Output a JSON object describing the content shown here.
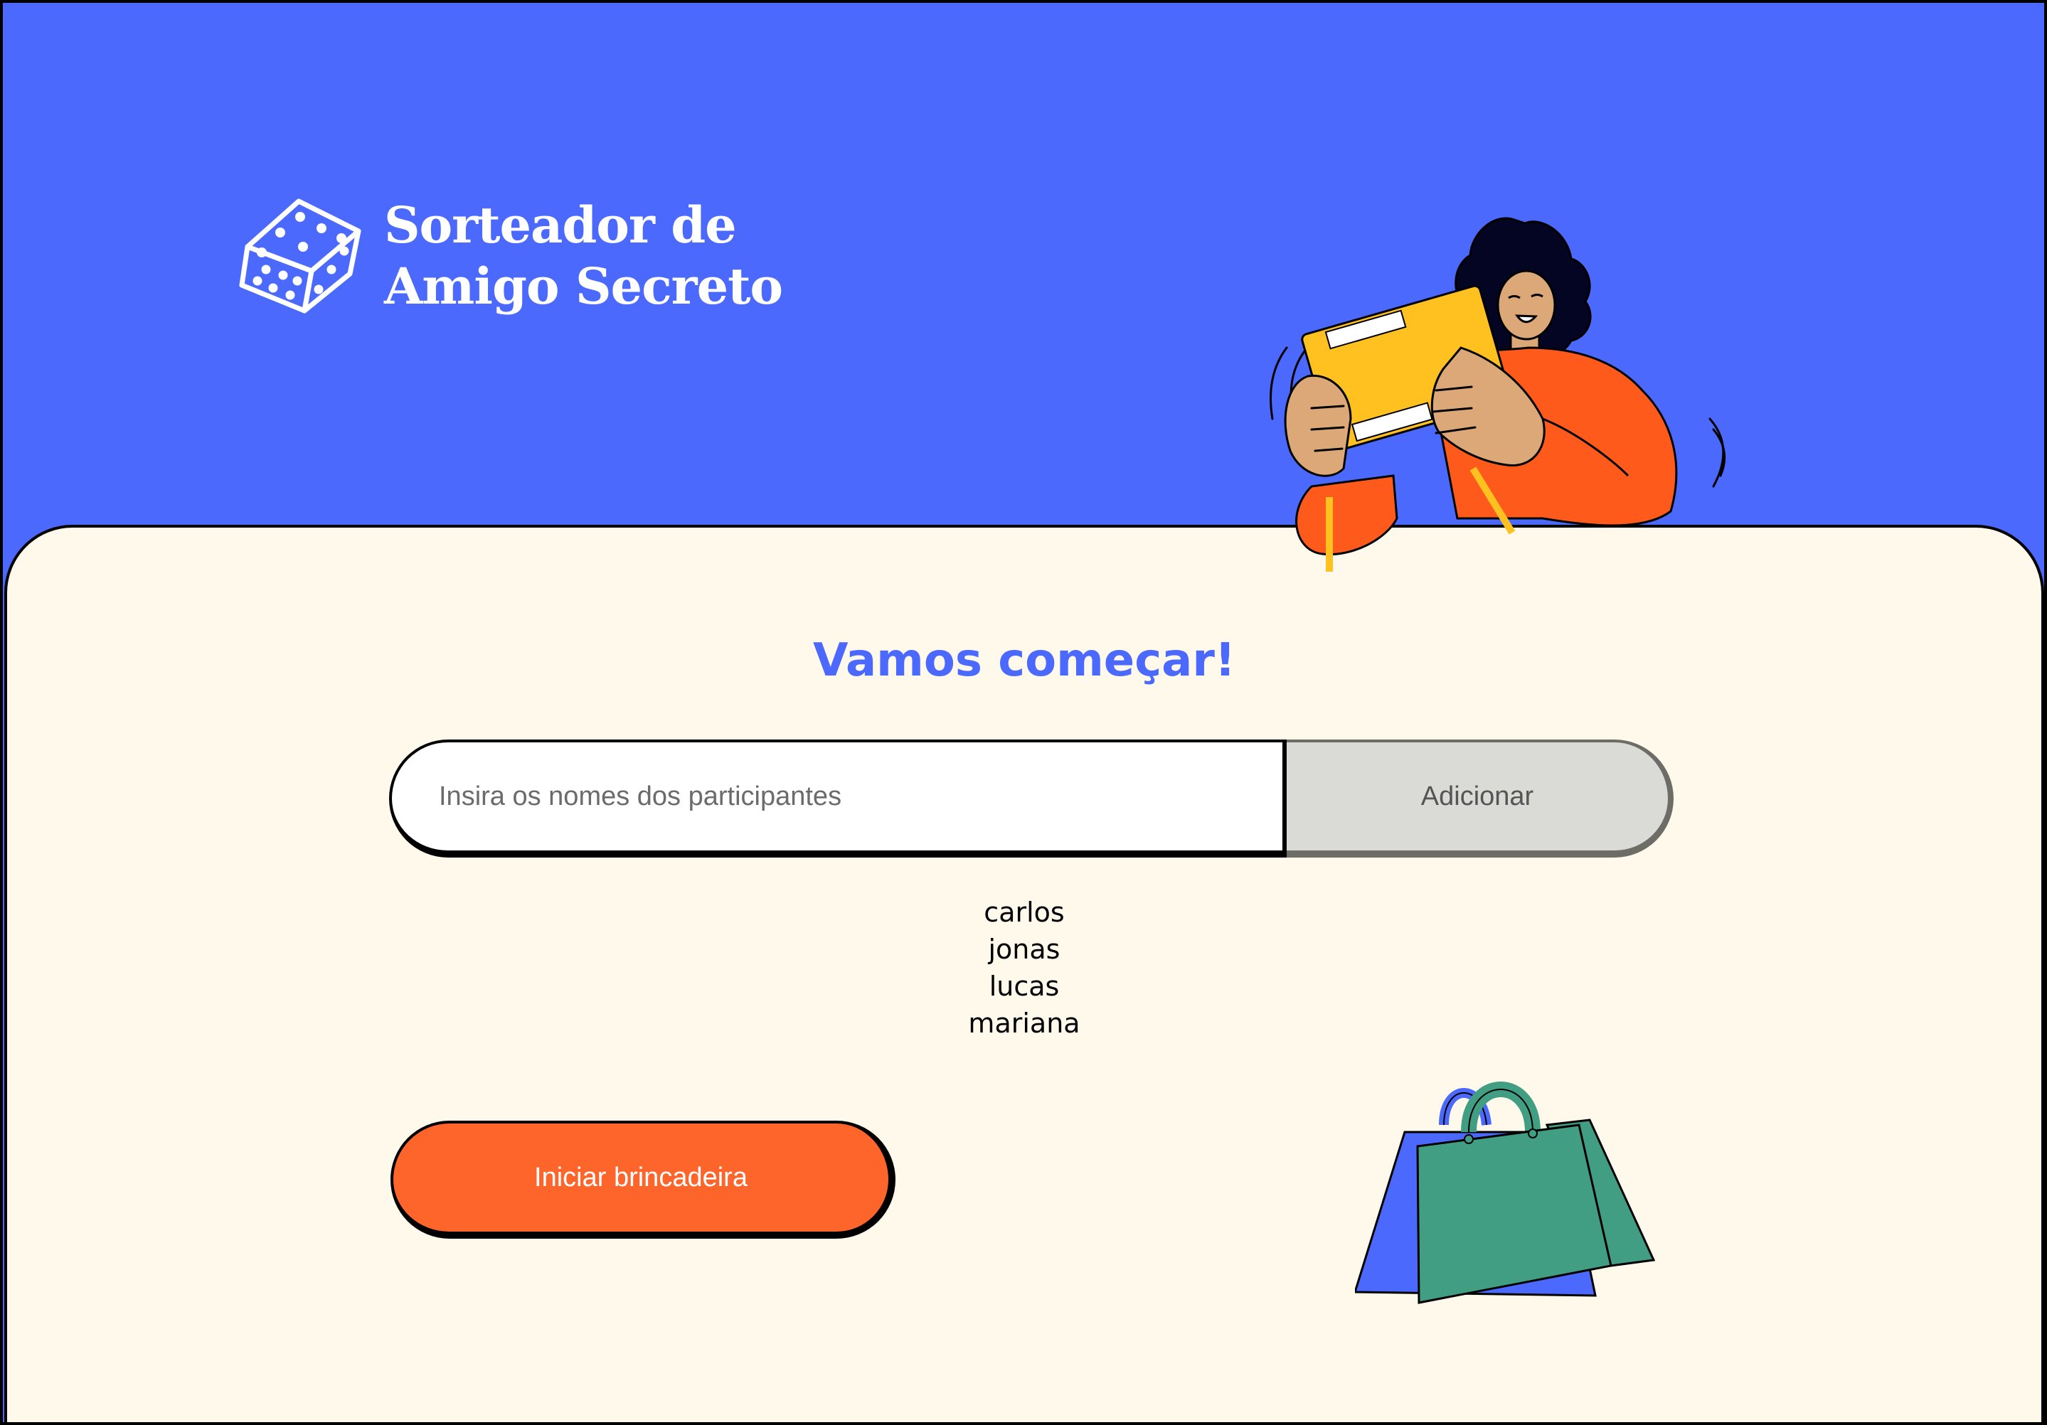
{
  "header": {
    "logo_line1": "Sorteador de",
    "logo_line2": "Amigo Secreto"
  },
  "main": {
    "title": "Vamos começar!",
    "input_placeholder": "Insira os nomes dos participantes",
    "input_value": "",
    "add_button_label": "Adicionar",
    "participants": [
      "carlos",
      "jonas",
      "lucas",
      "mariana"
    ],
    "start_button_label": "Iniciar brincadeira"
  },
  "icons": {
    "logo": "dice-icon",
    "hero": "person-holding-gift-illustration",
    "decoration": "shopping-bags-illustration"
  },
  "colors": {
    "background_blue": "#4B69FD",
    "card_cream": "#FFF9EB",
    "accent_orange": "#FE652B",
    "button_gray": "#DADAD6",
    "bag_green": "#419E83",
    "gift_yellow": "#FFC11F"
  }
}
